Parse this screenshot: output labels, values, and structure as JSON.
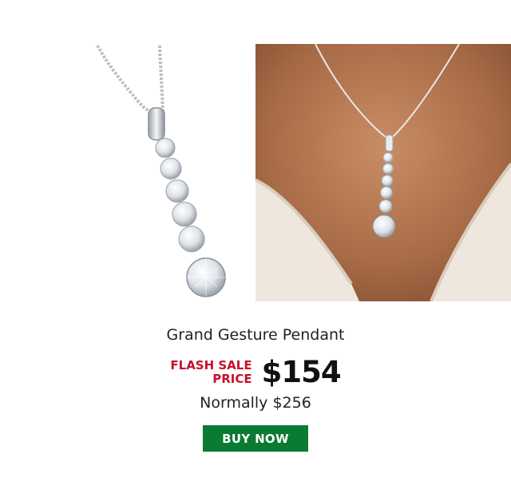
{
  "product": {
    "name": "Grand Gesture Pendant",
    "flash_sale_line1": "FLASH SALE",
    "flash_sale_line2": "PRICE",
    "sale_price": "$154",
    "normal_price": "Normally $256",
    "buy_label": "BUY NOW"
  },
  "images": [
    {
      "name": "pendant-product-photo"
    },
    {
      "name": "pendant-model-photo"
    }
  ],
  "colors": {
    "flash_red": "#c8102e",
    "button_green": "#0b7a33"
  }
}
